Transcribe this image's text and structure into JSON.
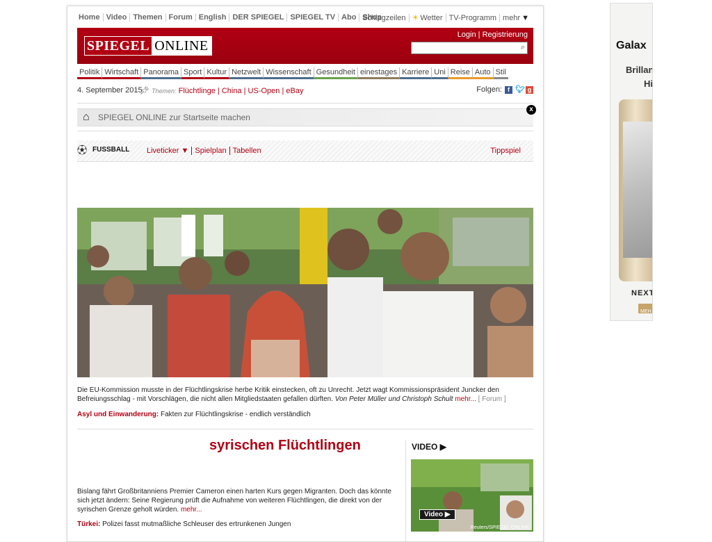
{
  "topnav": {
    "left": [
      "Home",
      "Video",
      "Themen",
      "Forum",
      "English",
      "DER SPIEGEL",
      "SPIEGEL TV",
      "Abo",
      "Shop"
    ],
    "schlagzeilen": "Schlagzeilen",
    "wetter": "Wetter",
    "tv": "TV-Programm",
    "mehr": "mehr"
  },
  "masthead": {
    "logo_a": "SPIEGEL",
    "logo_b": "ONLINE",
    "login": "Login | Registrierung",
    "search_placeholder": ""
  },
  "sections": [
    "Politik",
    "Wirtschaft",
    "Panorama",
    "Sport",
    "Kultur",
    "Netzwelt",
    "Wissenschaft",
    "Gesundheit",
    "einestages",
    "Karriere",
    "Uni",
    "Reise",
    "Auto",
    "Stil"
  ],
  "section_colors": [
    "#b10012",
    "#b10012",
    "#4a6d8c",
    "#b10012",
    "#b10012",
    "#4a6d8c",
    "#4a6d8c",
    "#6aa14d",
    "#8c7a5a",
    "#4a6d8c",
    "#4a6d8c",
    "#e89a26",
    "#e89a26",
    "#888888"
  ],
  "dateline": {
    "date": "4. September 2015",
    "themen_label": "Themen:",
    "topics": [
      "Flüchtlinge",
      "China",
      "US-Open",
      "eBay"
    ],
    "folgen": "Folgen:"
  },
  "startbar": {
    "text": "SPIEGEL ONLINE zur Startseite machen",
    "close": "x"
  },
  "fussball": {
    "label": "FUSSBALL",
    "links": [
      "Liveticker ▼",
      "Spielplan",
      "Tabellen"
    ],
    "tipp": "Tippspiel"
  },
  "lead": {
    "caption": "Die EU-Kommission musste in der Flüchtlingskrise herbe Kritik einstecken, oft zu Unrecht. Jetzt wagt Kommissionspräsident Juncker den Befreiungsschlag - mit Vorschlägen, die nicht allen Mitgliedstaaten gefallen dürften.",
    "authors": "Von Peter Müller und Christoph Schult",
    "more": "mehr...",
    "forum": "[ Forum ]",
    "asyl_label": "Asyl und Einwanderung:",
    "asyl_text": "Fakten zur Flüchtlingskrise - endlich verständlich"
  },
  "second": {
    "headline": "syrischen Flüchtlingen",
    "body": "Bislang fährt Großbritanniens Premier Cameron einen harten Kurs gegen Migranten. Doch das könnte sich jetzt ändern: Seine Regierung prüft die Aufnahme von weiteren Flüchtlingen, die direkt von der syrischen Grenze geholt würden.",
    "more": "mehr...",
    "tuerkei_label": "Türkei:",
    "tuerkei_text": "Polizei fasst mutmaßliche Schleuser des ertrunkenen Jungen"
  },
  "video": {
    "header": "VIDEO",
    "badge": "Video",
    "credit": "Reuters/SPIEGEL ONLINE"
  },
  "ad": {
    "line1": "Galax",
    "line2": "Brillan",
    "line3": "Hi",
    "next": "NEXT",
    "btn": "MEH"
  },
  "colors": {
    "brand_red": "#b10012",
    "link_red": "#b10012"
  }
}
